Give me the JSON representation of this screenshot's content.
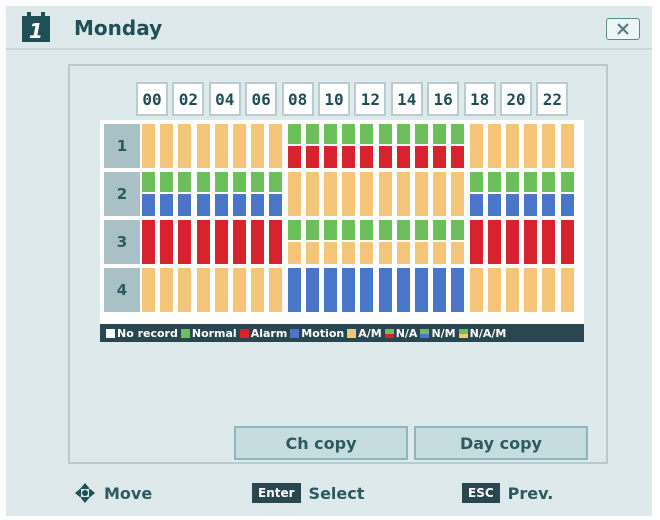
{
  "window": {
    "title": "Monday"
  },
  "hours": [
    "00",
    "02",
    "04",
    "06",
    "08",
    "10",
    "12",
    "14",
    "16",
    "18",
    "20",
    "22"
  ],
  "channels": [
    {
      "label": "1",
      "pattern": [
        "O",
        "O",
        "O",
        "O",
        "O",
        "O",
        "O",
        "O",
        "GR",
        "GR",
        "GR",
        "GR",
        "GR",
        "GR",
        "GR",
        "GR",
        "GR",
        "GR",
        "O",
        "O",
        "O",
        "O",
        "O",
        "O"
      ]
    },
    {
      "label": "2",
      "pattern": [
        "GB",
        "GB",
        "GB",
        "GB",
        "GB",
        "GB",
        "GB",
        "GB",
        "O",
        "O",
        "O",
        "O",
        "O",
        "O",
        "O",
        "O",
        "O",
        "O",
        "GB",
        "GB",
        "GB",
        "GB",
        "GB",
        "GB"
      ]
    },
    {
      "label": "3",
      "pattern": [
        "R",
        "R",
        "R",
        "R",
        "R",
        "R",
        "R",
        "R",
        "GO",
        "GO",
        "GO",
        "GO",
        "GO",
        "GO",
        "GO",
        "GO",
        "GO",
        "GO",
        "R",
        "R",
        "R",
        "R",
        "R",
        "R"
      ]
    },
    {
      "label": "4",
      "pattern": [
        "O",
        "O",
        "O",
        "O",
        "O",
        "O",
        "O",
        "O",
        "B",
        "B",
        "B",
        "B",
        "B",
        "B",
        "B",
        "B",
        "B",
        "B",
        "O",
        "O",
        "O",
        "O",
        "O",
        "O"
      ]
    }
  ],
  "colors": {
    "normal": "#6cbf5a",
    "alarm": "#d8232f",
    "motion": "#4a76c9",
    "am": "#f5c57a",
    "none": "#ffffff"
  },
  "legend": [
    {
      "label": "No record",
      "swatch": [
        "none"
      ]
    },
    {
      "label": "Normal",
      "swatch": [
        "normal"
      ]
    },
    {
      "label": "Alarm",
      "swatch": [
        "alarm"
      ]
    },
    {
      "label": "Motion",
      "swatch": [
        "motion"
      ]
    },
    {
      "label": "A/M",
      "swatch": [
        "am"
      ]
    },
    {
      "label": "N/A",
      "swatch": [
        "normal",
        "alarm"
      ]
    },
    {
      "label": "N/M",
      "swatch": [
        "normal",
        "motion"
      ]
    },
    {
      "label": "N/A/M",
      "swatch": [
        "normal",
        "am"
      ]
    }
  ],
  "buttons": {
    "ch_copy": "Ch copy",
    "day_copy": "Day copy"
  },
  "footer": {
    "move": "Move",
    "enter_key": "Enter",
    "select": "Select",
    "esc_key": "ESC",
    "prev": "Prev."
  }
}
